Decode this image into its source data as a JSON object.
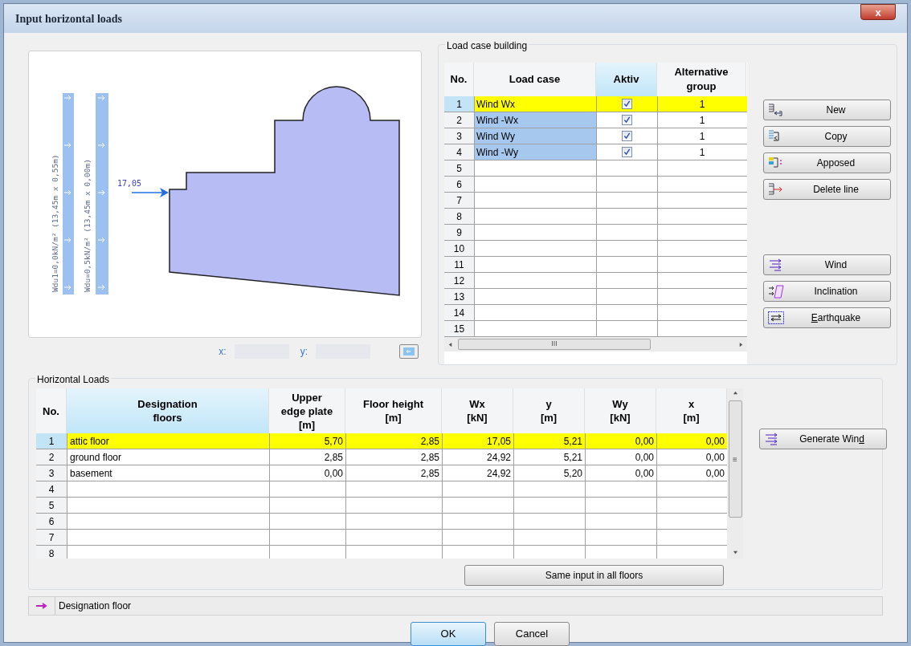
{
  "window": {
    "title": "Input horizontal loads",
    "close_label": "x"
  },
  "drawing": {
    "load_labels": [
      "Wdu1=0,0kN/m² (13,45m x 0,55m)",
      "Wdu=0,5kN/m² (13,45m x 0,00m)"
    ],
    "force_label": "17,05",
    "coord_x_label": "x:",
    "coord_y_label": "y:"
  },
  "load_case_building": {
    "title": "Load case building",
    "columns": [
      "No.",
      "Load case",
      "Aktiv",
      "Alternative\ngroup"
    ],
    "rows": [
      {
        "no": "1",
        "load_case": "Wind Wx",
        "checked": true,
        "group": "1",
        "selected": true,
        "highlighted": false
      },
      {
        "no": "2",
        "load_case": "Wind -Wx",
        "checked": true,
        "group": "1",
        "selected": false,
        "highlighted": true
      },
      {
        "no": "3",
        "load_case": "Wind Wy",
        "checked": true,
        "group": "1",
        "selected": false,
        "highlighted": true
      },
      {
        "no": "4",
        "load_case": "Wind -Wy",
        "checked": true,
        "group": "1",
        "selected": false,
        "highlighted": true
      },
      {
        "no": "5",
        "checked": false,
        "selected": false,
        "highlighted": false
      },
      {
        "no": "6",
        "checked": false,
        "selected": false,
        "highlighted": false
      },
      {
        "no": "7",
        "checked": false,
        "selected": false,
        "highlighted": false
      },
      {
        "no": "8",
        "checked": false,
        "selected": false,
        "highlighted": false
      },
      {
        "no": "9",
        "checked": false,
        "selected": false,
        "highlighted": false
      },
      {
        "no": "10",
        "checked": false,
        "selected": false,
        "highlighted": false
      },
      {
        "no": "11",
        "checked": false,
        "selected": false,
        "highlighted": false
      },
      {
        "no": "12",
        "checked": false,
        "selected": false,
        "highlighted": false
      },
      {
        "no": "13",
        "checked": false,
        "selected": false,
        "highlighted": false
      },
      {
        "no": "14",
        "checked": false,
        "selected": false,
        "highlighted": false
      },
      {
        "no": "15",
        "checked": false,
        "selected": false,
        "highlighted": false
      }
    ],
    "scroll_grip": "III",
    "buttons": [
      {
        "label": "New",
        "kind": "new"
      },
      {
        "label": "Copy",
        "kind": "copy"
      },
      {
        "label": "Apposed",
        "kind": "apposed"
      },
      {
        "label": "Delete line",
        "kind": "delete"
      }
    ],
    "tool_buttons": [
      {
        "label": "Wind",
        "kind": "wind"
      },
      {
        "label": "Inclination",
        "kind": "inclination"
      },
      {
        "label_parts": {
          "key": "E",
          "after": "arthquake"
        },
        "kind": "earthquake"
      }
    ]
  },
  "horizontal_loads": {
    "title": "Horizontal Loads",
    "columns": [
      "No.",
      "Designation\nfloors",
      "Upper\nedge plate\n[m]",
      "Floor height\n[m]",
      "Wx\n[kN]",
      "y\n[m]",
      "Wy\n[kN]",
      "x\n[m]"
    ],
    "rows": [
      {
        "cells": [
          "1",
          "attic floor",
          "5,70",
          "2,85",
          "17,05",
          "5,21",
          "0,00",
          "0,00"
        ],
        "selected": true
      },
      {
        "cells": [
          "2",
          "ground floor",
          "2,85",
          "2,85",
          "24,92",
          "5,21",
          "0,00",
          "0,00"
        ],
        "selected": false
      },
      {
        "cells": [
          "3",
          "basement",
          "0,00",
          "2,85",
          "24,92",
          "5,20",
          "0,00",
          "0,00"
        ],
        "selected": false
      },
      {
        "cells": [
          "4"
        ],
        "selected": false
      },
      {
        "cells": [
          "5"
        ],
        "selected": false
      },
      {
        "cells": [
          "6"
        ],
        "selected": false
      },
      {
        "cells": [
          "7"
        ],
        "selected": false
      },
      {
        "cells": [
          "8"
        ],
        "selected": false
      }
    ],
    "scroll_grip": "≡",
    "generate_button": {
      "label_parts": {
        "before": "Generate Win",
        "key": "d"
      }
    },
    "same_input_button": "Same input in all floors"
  },
  "status_bar": {
    "text": "Designation floor"
  },
  "buttons": [
    {
      "label": "OK",
      "default": true
    },
    {
      "label": "Cancel",
      "default": false
    }
  ]
}
